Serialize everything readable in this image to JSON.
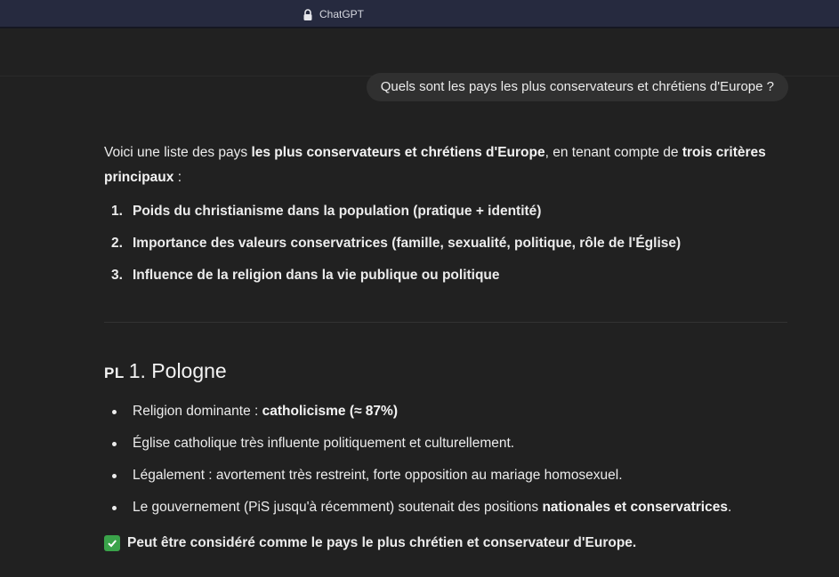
{
  "browser": {
    "site_label": "ChatGPT"
  },
  "user_message": "Quels sont les pays les plus conservateurs et chrétiens d'Europe ?",
  "answer": {
    "intro_parts": [
      {
        "text": "Voici une liste des pays ",
        "bold": false
      },
      {
        "text": "les plus conservateurs et chrétiens d'Europe",
        "bold": true
      },
      {
        "text": ", en tenant compte de ",
        "bold": false
      },
      {
        "text": "trois critères principaux",
        "bold": true
      },
      {
        "text": " :",
        "bold": false
      }
    ],
    "criteria": [
      {
        "num": "1.",
        "text": "Poids du christianisme dans la population (pratique + identité)"
      },
      {
        "num": "2.",
        "text": "Importance des valeurs conservatrices (famille, sexualité, politique, rôle de l'Église)"
      },
      {
        "num": "3.",
        "text": "Influence de la religion dans la vie publique ou politique"
      }
    ],
    "section": {
      "flag": "PL",
      "title": "1. Pologne",
      "points": [
        {
          "parts": [
            {
              "text": "Religion dominante : ",
              "bold": false
            },
            {
              "text": "catholicisme (≈ 87%)",
              "bold": true
            }
          ]
        },
        {
          "parts": [
            {
              "text": "Église catholique très influente politiquement et culturellement.",
              "bold": false
            }
          ]
        },
        {
          "parts": [
            {
              "text": "Légalement : avortement très restreint, forte opposition au mariage homosexuel.",
              "bold": false
            }
          ]
        },
        {
          "parts": [
            {
              "text": "Le gouvernement (PiS jusqu'à récemment) soutenait des positions ",
              "bold": false
            },
            {
              "text": "nationales et conservatrices",
              "bold": true
            },
            {
              "text": ".",
              "bold": false
            }
          ]
        }
      ],
      "conclusion": "Peut être considéré comme le pays le plus chrétien et conservateur d'Europe."
    }
  },
  "icons": {
    "lock": "lock-icon",
    "check": "check-icon"
  },
  "colors": {
    "background": "#212121",
    "titlebar": "#262a3f",
    "bubble": "#303030",
    "check": "#3aa34a"
  }
}
